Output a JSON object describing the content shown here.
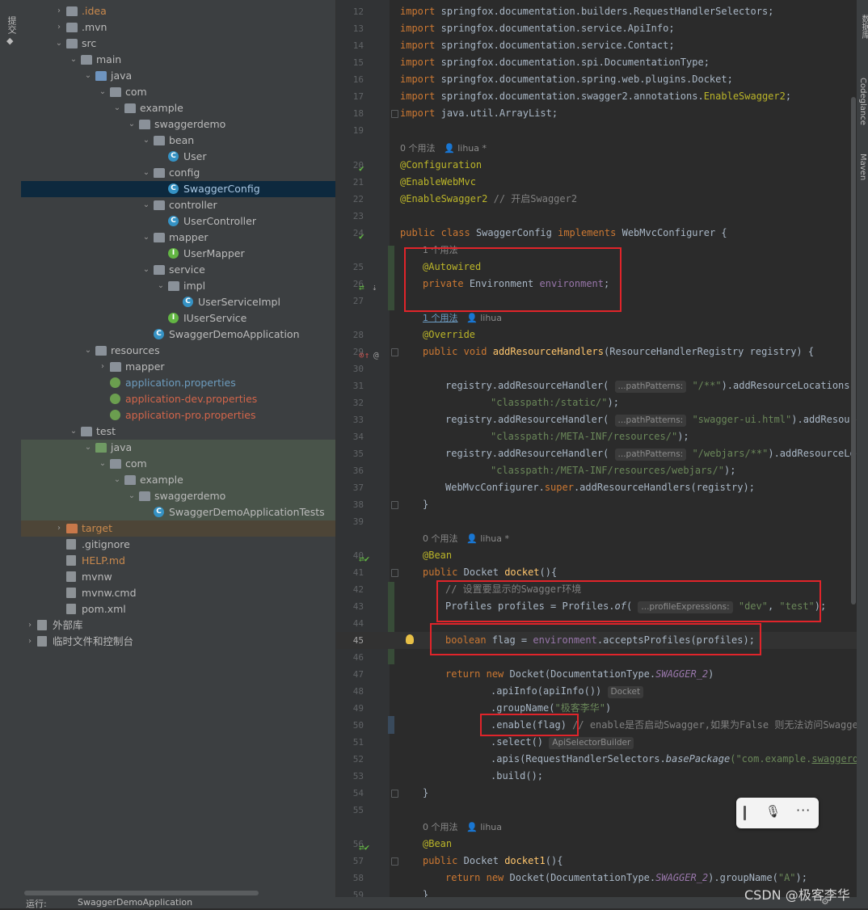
{
  "left_strip": {
    "tab_label": "提交"
  },
  "tree": [
    {
      "label": ".idea",
      "depth": 2,
      "icon": "folder-icon",
      "exp": "collapsed",
      "cls": "c-orange"
    },
    {
      "label": ".mvn",
      "depth": 2,
      "icon": "folder-icon",
      "exp": "collapsed"
    },
    {
      "label": "src",
      "depth": 2,
      "icon": "folder-icon",
      "exp": "expanded"
    },
    {
      "label": "main",
      "depth": 3,
      "icon": "folder-icon",
      "exp": "expanded"
    },
    {
      "label": "java",
      "depth": 4,
      "icon": "source-folder-icon",
      "exp": "expanded"
    },
    {
      "label": "com",
      "depth": 5,
      "icon": "package-icon",
      "exp": "expanded"
    },
    {
      "label": "example",
      "depth": 6,
      "icon": "package-icon",
      "exp": "expanded"
    },
    {
      "label": "swaggerdemo",
      "depth": 7,
      "icon": "package-icon",
      "exp": "expanded"
    },
    {
      "label": "bean",
      "depth": 8,
      "icon": "package-icon",
      "exp": "expanded"
    },
    {
      "label": "User",
      "depth": 9,
      "icon": "class-icon",
      "exp": "none"
    },
    {
      "label": "config",
      "depth": 8,
      "icon": "package-icon",
      "exp": "expanded"
    },
    {
      "label": "SwaggerConfig",
      "depth": 9,
      "icon": "class-icon",
      "exp": "none",
      "cls": "c-sel",
      "sel": true
    },
    {
      "label": "controller",
      "depth": 8,
      "icon": "package-icon",
      "exp": "expanded"
    },
    {
      "label": "UserController",
      "depth": 9,
      "icon": "class-icon",
      "exp": "none"
    },
    {
      "label": "mapper",
      "depth": 8,
      "icon": "package-icon",
      "exp": "expanded"
    },
    {
      "label": "UserMapper",
      "depth": 9,
      "icon": "interface-icon",
      "exp": "none"
    },
    {
      "label": "service",
      "depth": 8,
      "icon": "package-icon",
      "exp": "expanded"
    },
    {
      "label": "impl",
      "depth": 9,
      "icon": "package-icon",
      "exp": "expanded"
    },
    {
      "label": "UserServiceImpl",
      "depth": 10,
      "icon": "class-icon",
      "exp": "none"
    },
    {
      "label": "IUserService",
      "depth": 9,
      "icon": "interface-icon",
      "exp": "none"
    },
    {
      "label": "SwaggerDemoApplication",
      "depth": 8,
      "icon": "spring-class-icon",
      "exp": "none"
    },
    {
      "label": "resources",
      "depth": 4,
      "icon": "resources-folder-icon",
      "exp": "expanded"
    },
    {
      "label": "mapper",
      "depth": 5,
      "icon": "folder-icon",
      "exp": "collapsed"
    },
    {
      "label": "application.properties",
      "depth": 5,
      "icon": "spring-leaf-icon",
      "exp": "none",
      "cls": "c-blue"
    },
    {
      "label": "application-dev.properties",
      "depth": 5,
      "icon": "spring-leaf-icon",
      "exp": "none",
      "cls": "c-red"
    },
    {
      "label": "application-pro.properties",
      "depth": 5,
      "icon": "spring-leaf-icon",
      "exp": "none",
      "cls": "c-red"
    },
    {
      "label": "test",
      "depth": 3,
      "icon": "folder-icon",
      "exp": "expanded"
    },
    {
      "label": "java",
      "depth": 4,
      "icon": "test-folder-icon",
      "exp": "expanded",
      "bg": "testbg"
    },
    {
      "label": "com",
      "depth": 5,
      "icon": "package-icon",
      "exp": "expanded",
      "bg": "testbg"
    },
    {
      "label": "example",
      "depth": 6,
      "icon": "package-icon",
      "exp": "expanded",
      "bg": "testbg"
    },
    {
      "label": "swaggerdemo",
      "depth": 7,
      "icon": "package-icon",
      "exp": "expanded",
      "bg": "testbg"
    },
    {
      "label": "SwaggerDemoApplicationTests",
      "depth": 8,
      "icon": "spring-class-icon",
      "exp": "none",
      "bg": "testbg"
    },
    {
      "label": "target",
      "depth": 2,
      "icon": "excluded-folder-icon",
      "exp": "collapsed",
      "cls": "c-orange",
      "bg": "tgtbg"
    },
    {
      "label": ".gitignore",
      "depth": 2,
      "icon": "file-icon",
      "exp": "none"
    },
    {
      "label": "HELP.md",
      "depth": 2,
      "icon": "markdown-file-icon",
      "exp": "none",
      "cls": "c-orange"
    },
    {
      "label": "mvnw",
      "depth": 2,
      "icon": "file-icon",
      "exp": "none"
    },
    {
      "label": "mvnw.cmd",
      "depth": 2,
      "icon": "file-icon",
      "exp": "none"
    },
    {
      "label": "pom.xml",
      "depth": 2,
      "icon": "maven-file-icon",
      "exp": "none"
    },
    {
      "label": "外部库",
      "depth": 0,
      "icon": "library-icon",
      "exp": "collapsed"
    },
    {
      "label": "临时文件和控制台",
      "depth": 0,
      "icon": "scratch-icon",
      "exp": "collapsed"
    }
  ],
  "code": {
    "imports": [
      "springfox.documentation.builders.RequestHandlerSelectors",
      "springfox.documentation.service.ApiInfo",
      "springfox.documentation.service.Contact",
      "springfox.documentation.spi.DocumentationType",
      "springfox.documentation.spring.web.plugins.Docket",
      "springfox.documentation.swagger2.annotations.",
      "java.util.ArrayList"
    ],
    "enable_swagger2": "EnableSwagger2",
    "kw_import": "import",
    "usage_0": "0 个用法",
    "usage_1": "1 个用法",
    "author": "lihua",
    "author_mod": "lihua *",
    "ann_configuration": "@Configuration",
    "ann_enablewebmvc": "@EnableWebMvc",
    "ann_enableswagger2": "@EnableSwagger2",
    "comment_enable": "// 开启Swagger2",
    "kw_public": "public",
    "kw_class": "class",
    "class_name": "SwaggerConfig",
    "kw_implements": "implements",
    "iface": "WebMvcConfigurer {",
    "ann_autowired": "@Autowired",
    "kw_private": "private",
    "type_env": "Environment",
    "field_env": "environment",
    "ann_override": "@Override",
    "kw_void": "void",
    "method_add": "addResourceHandlers",
    "params_add": "(ResourceHandlerRegistry registry) {",
    "reg_call": "registry.addResourceHandler(",
    "path_hint": "...pathPatterns:",
    "p1": "\"/**\"",
    "p2": "\"swagger-ui.html\"",
    "p3": "\"/webjars/**\"",
    "add_loc": ").addResourceLocations(",
    "add_loc2": ").addResourceLo",
    "add_loc3": ").addResourceLocati",
    "l1": "\"classpath:/static/\"",
    "l2": "\"classpath:/META-INF/resources/\"",
    "l3": "\"classpath:/META-INF/resources/webjars/\"",
    "close_paren": ");",
    "super_prefix": "WebMvcConfigurer.",
    "kw_super": "super",
    "super_call": ".addResourceHandlers(registry);",
    "brace_close": "}",
    "ann_bean": "@Bean",
    "type_docket": "Docket",
    "method_docket": "docket",
    "method_docket1": "docket1",
    "method_suffix": "(){",
    "comment_env": "// 设置要显示的Swagger环境",
    "profiles_decl": "Profiles profiles = Profiles.",
    "of": "of",
    "profile_hint": "...profileExpressions:",
    "dev": "\"dev\"",
    "test": "\"test\"",
    "kw_boolean": "boolean",
    "flag_decl": " flag = ",
    "accepts": ".acceptsProfiles(profiles);",
    "kw_return": "return",
    "kw_new": "new",
    "docket_new": " Docket(DocumentationType.",
    "swagger2_const": "SWAGGER_2",
    "close_one": ")",
    "apiinfo": ".apiInfo(apiInfo())",
    "hint_docket": "Docket",
    "groupname": ".groupName(",
    "group_val": "\"极客李华\"",
    "enable": ".enable(flag)",
    "enable_comment": "// enable是否启动Swagger,如果为False 则无法访问Swagger",
    "select": ".select()",
    "hint_selector": "ApiSelectorBuilder",
    "apis": ".apis(RequestHandlerSelectors.",
    "basepackage": "basePackage",
    "base_val": "(\"com.example.",
    "base_val2": "swaggerdem",
    "build": ".build();",
    "group_a_prefix": ").groupName(",
    "group_a": "\"A\"",
    "comma": ", "
  },
  "right_strip": {
    "tabs": [
      "数据库",
      "Codeglance",
      "Maven"
    ]
  },
  "statusbar": {
    "run_label": "运行:",
    "app_label": "SwaggerDemoApplication"
  },
  "watermark": "CSDN @极客李华"
}
